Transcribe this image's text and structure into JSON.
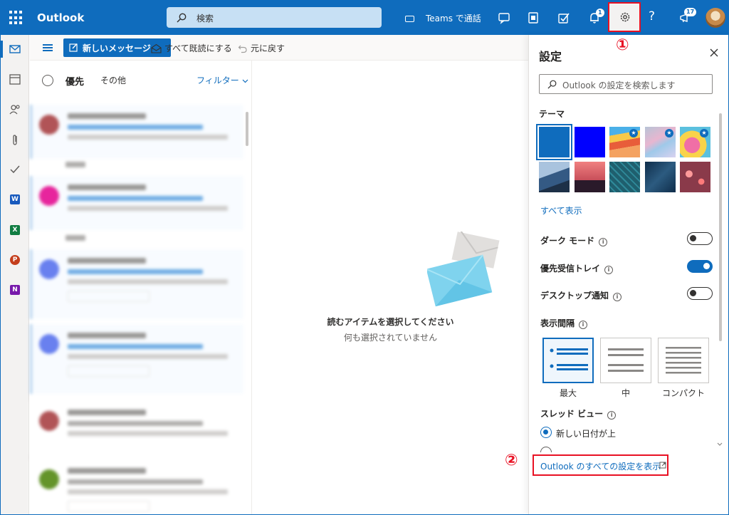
{
  "topbar": {
    "app_name": "Outlook",
    "search_placeholder": "検索",
    "teams_label": "Teams で通話",
    "notifications_badge": "1",
    "whatsnew_badge": "17",
    "help": "?"
  },
  "commandbar": {
    "new_message": "新しいメッセージ",
    "mark_all_read": "すべて既読にする",
    "undo": "元に戻す"
  },
  "maillist": {
    "tab_focused": "優先",
    "tab_other": "その他",
    "filter": "フィルター"
  },
  "reading": {
    "title": "読むアイテムを選択してください",
    "subtitle": "何も選択されていません"
  },
  "settings": {
    "title": "設定",
    "search_placeholder": "Outlook の設定を検索します",
    "theme_heading": "テーマ",
    "show_all": "すべて表示",
    "dark_mode": "ダーク モード",
    "focused_inbox": "優先受信トレイ",
    "desktop_notifications": "デスクトップ通知",
    "display_density": "表示間隔",
    "density_options": [
      "最大",
      "中",
      "コンパクト"
    ],
    "thread_view": "スレッド ビュー",
    "thread_option_selected": "新しい日付が上",
    "view_all_settings": "Outlook のすべての設定を表示",
    "toggles": {
      "dark_mode": false,
      "focused_inbox": true,
      "desktop_notifications": false
    }
  },
  "callouts": {
    "one": "①",
    "two": "②"
  },
  "colors": {
    "brand": "#0f6cbd",
    "callout_red": "#e81123"
  }
}
